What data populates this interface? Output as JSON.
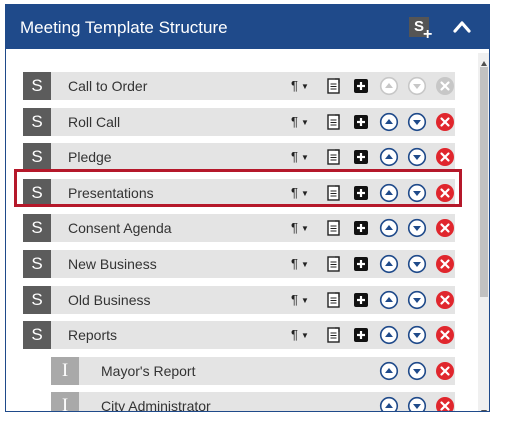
{
  "header": {
    "title": "Meeting Template Structure",
    "add_section_letter": "S",
    "add_section_plus": "+"
  },
  "rows": [
    {
      "type": "section",
      "badge": "S",
      "label": "Call to Order",
      "up_enabled": false,
      "down_enabled": false,
      "delete_enabled": false
    },
    {
      "type": "section",
      "badge": "S",
      "label": "Roll Call",
      "up_enabled": true,
      "down_enabled": true,
      "delete_enabled": true
    },
    {
      "type": "section",
      "badge": "S",
      "label": "Pledge",
      "up_enabled": true,
      "down_enabled": true,
      "delete_enabled": true
    },
    {
      "type": "section",
      "badge": "S",
      "label": "Presentations",
      "up_enabled": true,
      "down_enabled": true,
      "delete_enabled": true,
      "highlighted": true
    },
    {
      "type": "section",
      "badge": "S",
      "label": "Consent Agenda",
      "up_enabled": true,
      "down_enabled": true,
      "delete_enabled": true
    },
    {
      "type": "section",
      "badge": "S",
      "label": "New Business",
      "up_enabled": true,
      "down_enabled": true,
      "delete_enabled": true
    },
    {
      "type": "section",
      "badge": "S",
      "label": "Old Business",
      "up_enabled": true,
      "down_enabled": true,
      "delete_enabled": true
    },
    {
      "type": "section",
      "badge": "S",
      "label": "Reports",
      "up_enabled": true,
      "down_enabled": true,
      "delete_enabled": true
    },
    {
      "type": "item",
      "badge": "I",
      "label": "Mayor's Report",
      "up_enabled": true,
      "down_enabled": true,
      "delete_enabled": true
    },
    {
      "type": "item",
      "badge": "I",
      "label": "City Administrator",
      "up_enabled": true,
      "down_enabled": true,
      "delete_enabled": true
    }
  ],
  "controls": {
    "paragraph_symbol": "¶",
    "caret": "▼"
  },
  "colors": {
    "header_bg": "#1f4a8a",
    "enabled_arrow": "#1f4a8a",
    "disabled": "#c7c7c7",
    "delete": "#e0262d",
    "highlight": "#b5182a"
  },
  "icons": {
    "add_section": "add-section-icon",
    "collapse": "chevron-up-icon",
    "format": "paragraph-icon",
    "document": "document-icon",
    "add": "plus-square-icon",
    "move_up": "arrow-up-circle-icon",
    "move_down": "arrow-down-circle-icon",
    "delete": "x-circle-icon"
  }
}
